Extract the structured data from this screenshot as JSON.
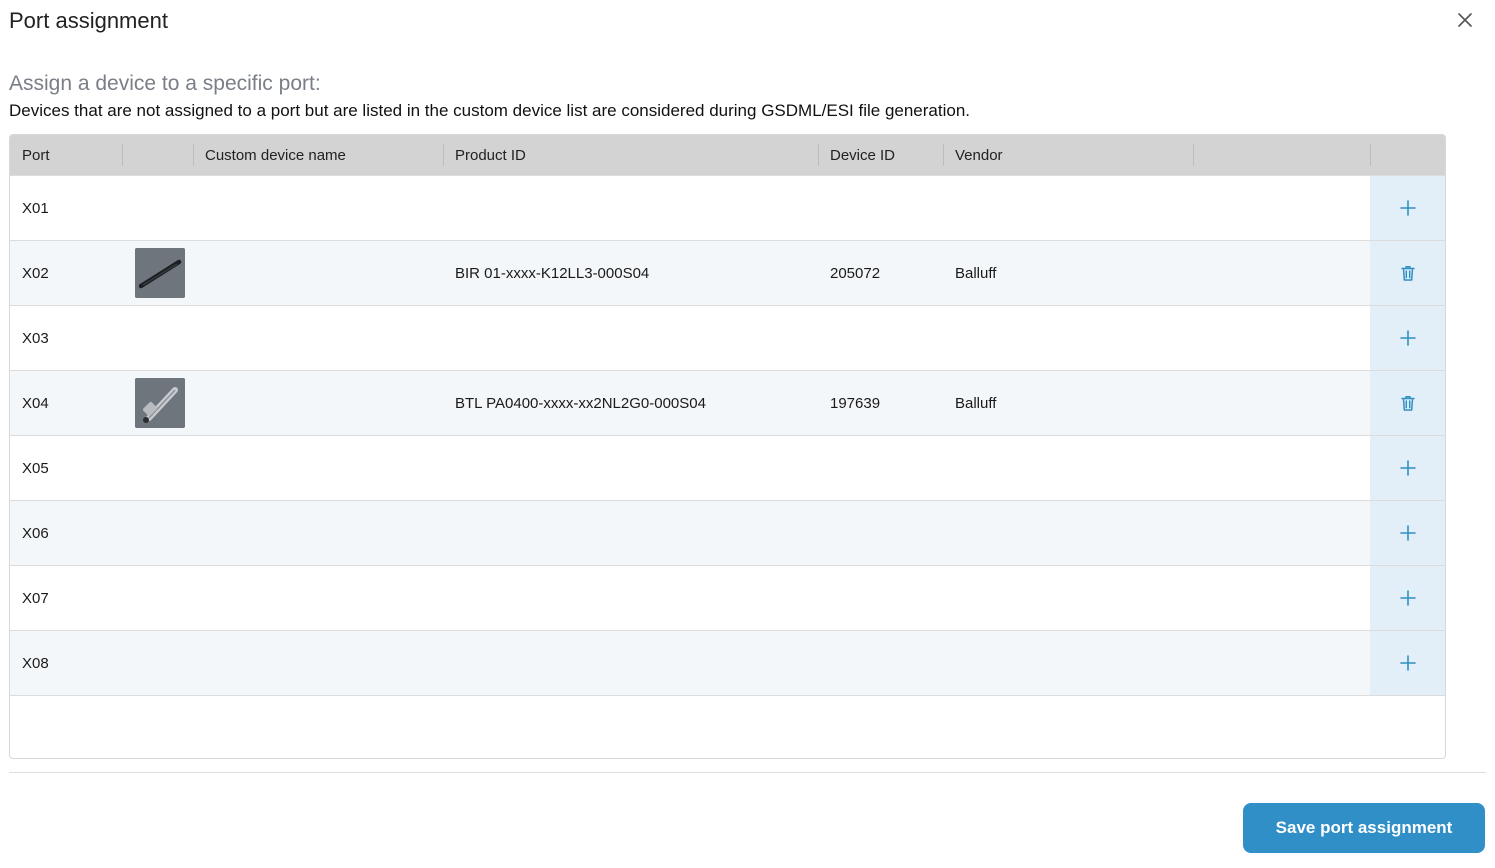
{
  "dialog": {
    "title": "Port assignment",
    "subtitle": "Assign a device to a specific port:",
    "description": "Devices that are not assigned to a port but are listed in the custom device list are considered during GSDML/ESI file generation."
  },
  "table": {
    "headers": {
      "port": "Port",
      "image": "",
      "custom_name": "Custom device name",
      "product_id": "Product ID",
      "device_id": "Device ID",
      "vendor": "Vendor",
      "extra": "",
      "action": ""
    },
    "rows": [
      {
        "port": "X01",
        "custom_name": "",
        "product_id": "",
        "device_id": "",
        "vendor": "",
        "image": "",
        "action": "add"
      },
      {
        "port": "X02",
        "custom_name": "",
        "product_id": "BIR 01-xxxx-K12LL3-000S04",
        "device_id": "205072",
        "vendor": "Balluff",
        "image": "bir-sensor-thumbnail",
        "action": "delete"
      },
      {
        "port": "X03",
        "custom_name": "",
        "product_id": "",
        "device_id": "",
        "vendor": "",
        "image": "",
        "action": "add"
      },
      {
        "port": "X04",
        "custom_name": "",
        "product_id": "BTL PA0400-xxxx-xx2NL2G0-000S04",
        "device_id": "197639",
        "vendor": "Balluff",
        "image": "btl-transducer-thumbnail",
        "action": "delete"
      },
      {
        "port": "X05",
        "custom_name": "",
        "product_id": "",
        "device_id": "",
        "vendor": "",
        "image": "",
        "action": "add"
      },
      {
        "port": "X06",
        "custom_name": "",
        "product_id": "",
        "device_id": "",
        "vendor": "",
        "image": "",
        "action": "add"
      },
      {
        "port": "X07",
        "custom_name": "",
        "product_id": "",
        "device_id": "",
        "vendor": "",
        "image": "",
        "action": "add"
      },
      {
        "port": "X08",
        "custom_name": "",
        "product_id": "",
        "device_id": "",
        "vendor": "",
        "image": "",
        "action": "add"
      }
    ]
  },
  "footer": {
    "save_label": "Save port assignment"
  },
  "icons": {
    "close": "close-icon",
    "add": "plus-icon",
    "delete": "trash-icon"
  },
  "colors": {
    "header_bg": "#d3d3d3",
    "row_alt_bg": "#f4f7fa",
    "action_bg": "#e3eff8",
    "accent": "#2f8fc6",
    "subtitle": "#7a7f87"
  }
}
